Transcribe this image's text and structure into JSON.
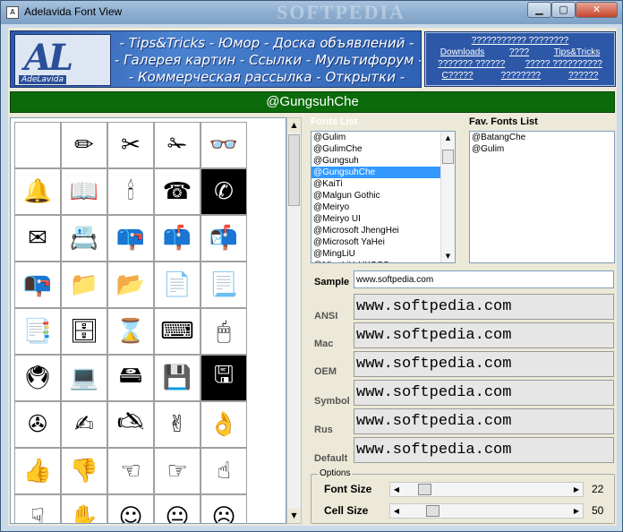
{
  "window": {
    "title": "Adelavida Font View",
    "watermark": "SOFTPEDIA"
  },
  "banner": {
    "logo_letters": "AL",
    "logo_name": "AdeLavida",
    "lines": [
      "- Tips&Tricks - Юмор - Доска объявлений -",
      "- Галерея картин - Ссылки - Мультифорум -",
      "- Коммерческая рассылка - Открытки -"
    ]
  },
  "link_box": {
    "rows": [
      [
        "??????????? ????????"
      ],
      [
        "Downloads",
        "????",
        "Tips&Tricks"
      ],
      [
        "??????? ??????",
        "????? ??????????"
      ],
      [
        "C?????",
        "????????",
        "??????"
      ]
    ]
  },
  "current_font": "@GungsuhChe",
  "glyphs": [
    {
      "g": ""
    },
    {
      "g": "✏"
    },
    {
      "g": "✂"
    },
    {
      "g": "✁"
    },
    {
      "g": "👓"
    },
    {
      "g": "🔔"
    },
    {
      "g": "📖"
    },
    {
      "g": "🕯"
    },
    {
      "g": "☎"
    },
    {
      "g": "✆",
      "inverted": true
    },
    {
      "g": "✉"
    },
    {
      "g": "📇"
    },
    {
      "g": "📪"
    },
    {
      "g": "📫"
    },
    {
      "g": "📬"
    },
    {
      "g": "📭"
    },
    {
      "g": "📁"
    },
    {
      "g": "📂"
    },
    {
      "g": "📄"
    },
    {
      "g": "📃"
    },
    {
      "g": "📑"
    },
    {
      "g": "🗄"
    },
    {
      "g": "⌛"
    },
    {
      "g": "⌨"
    },
    {
      "g": "🖱"
    },
    {
      "g": "🖲"
    },
    {
      "g": "💻"
    },
    {
      "g": "🖴"
    },
    {
      "g": "💾"
    },
    {
      "g": "🖫",
      "inverted": true
    },
    {
      "g": "✇"
    },
    {
      "g": "✍"
    },
    {
      "g": "🖎"
    },
    {
      "g": "✌"
    },
    {
      "g": "👌"
    },
    {
      "g": "👍"
    },
    {
      "g": "👎"
    },
    {
      "g": "☜"
    },
    {
      "g": "☞"
    },
    {
      "g": "☝"
    },
    {
      "g": "☟"
    },
    {
      "g": "✋"
    },
    {
      "g": "☺"
    },
    {
      "g": "😐"
    },
    {
      "g": "☹"
    }
  ],
  "fonts_list": {
    "label": "Fonts List",
    "items": [
      "@Gulim",
      "@GulimChe",
      "@Gungsuh",
      "@GungsuhChe",
      "@KaiTi",
      "@Malgun Gothic",
      "@Meiryo",
      "@Meiryo UI",
      "@Microsoft JhengHei",
      "@Microsoft YaHei",
      "@MingLiU",
      "@MingLiU-HKSCS"
    ],
    "selected_index": 3
  },
  "fav_fonts": {
    "label": "Fav. Fonts List",
    "items": [
      "@BatangChe",
      "@Gulim"
    ]
  },
  "sample": {
    "label": "Sample",
    "value": "www.softpedia.com"
  },
  "encodings": [
    {
      "label": "ANSI",
      "text": "www.softpedia.com"
    },
    {
      "label": "Mac",
      "text": "www.softpedia.com"
    },
    {
      "label": "OEM",
      "text": "www.softpedia.com"
    },
    {
      "label": "Symbol",
      "text": "www.softpedia.com"
    },
    {
      "label": "Rus",
      "text": "www.softpedia.com"
    },
    {
      "label": "Default",
      "text": "www.softpedia.com"
    }
  ],
  "options": {
    "legend": "Options",
    "font_size": {
      "label": "Font Size",
      "value": "22",
      "fraction": 0.1
    },
    "cell_size": {
      "label": "Cell Size",
      "value": "50",
      "fraction": 0.15
    }
  }
}
